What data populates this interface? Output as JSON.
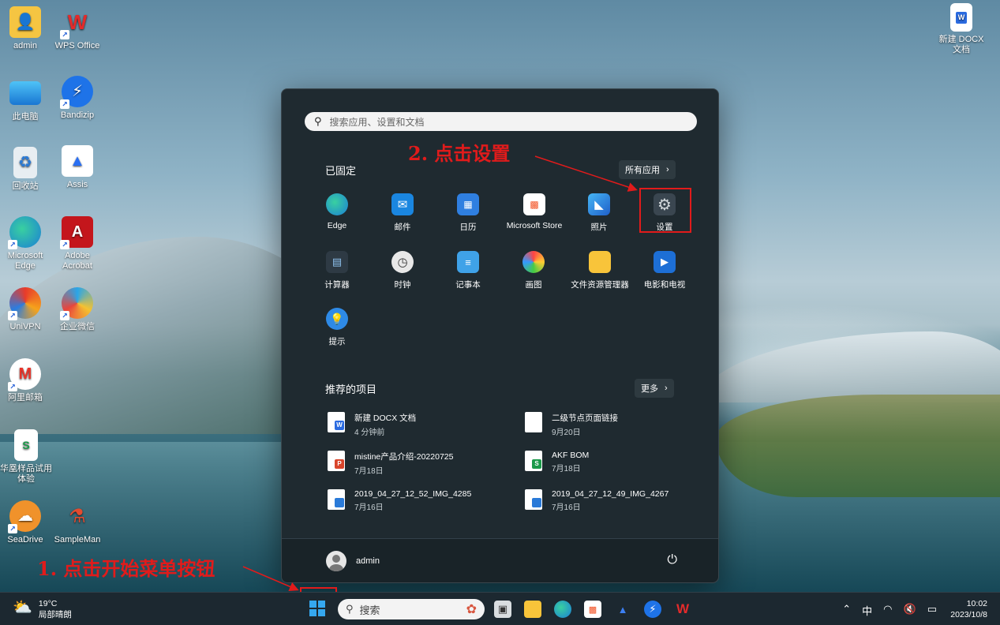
{
  "desktop": {
    "icons": [
      {
        "label": "admin",
        "icon": "user-folder-icon"
      },
      {
        "label": "WPS Office",
        "icon": "wps-icon"
      },
      {
        "label": "此电脑",
        "icon": "computer-icon"
      },
      {
        "label": "Bandizip",
        "icon": "bandizip-icon"
      },
      {
        "label": "回收站",
        "icon": "recycle-bin-icon"
      },
      {
        "label": "Assis",
        "icon": "assis-icon"
      },
      {
        "label": "Microsoft Edge",
        "icon": "edge-icon"
      },
      {
        "label": "Adobe Acrobat",
        "icon": "acrobat-icon"
      },
      {
        "label": "UniVPN",
        "icon": "univpn-icon"
      },
      {
        "label": "企业微信",
        "icon": "wecom-icon"
      },
      {
        "label": "阿里邮箱",
        "icon": "aliyun-mail-icon"
      },
      {
        "label": "华凰样品试用体验",
        "icon": "spreadsheet-file-icon"
      },
      {
        "label": "SeaDrive",
        "icon": "seadrive-icon"
      },
      {
        "label": "SampleMan",
        "icon": "sampleman-icon"
      },
      {
        "label": "新建 DOCX 文档",
        "icon": "word-file-icon"
      }
    ]
  },
  "start_menu": {
    "search_placeholder": "搜索应用、设置和文档",
    "pinned_title": "已固定",
    "all_apps_label": "所有应用",
    "pinned_apps": [
      {
        "label": "Edge",
        "icon": "edge-icon"
      },
      {
        "label": "邮件",
        "icon": "mail-icon"
      },
      {
        "label": "日历",
        "icon": "calendar-icon"
      },
      {
        "label": "Microsoft Store",
        "icon": "store-icon"
      },
      {
        "label": "照片",
        "icon": "photos-icon"
      },
      {
        "label": "设置",
        "icon": "settings-gear-icon"
      },
      {
        "label": "计算器",
        "icon": "calculator-icon"
      },
      {
        "label": "时钟",
        "icon": "clock-icon"
      },
      {
        "label": "记事本",
        "icon": "notepad-icon"
      },
      {
        "label": "画图",
        "icon": "paint-icon"
      },
      {
        "label": "文件资源管理器",
        "icon": "file-explorer-icon"
      },
      {
        "label": "电影和电视",
        "icon": "movies-tv-icon"
      },
      {
        "label": "提示",
        "icon": "tips-icon"
      }
    ],
    "recommended_title": "推荐的项目",
    "more_label": "更多",
    "recommended": [
      {
        "name": "新建 DOCX 文档",
        "time": "4 分钟前",
        "type": "W"
      },
      {
        "name": "二级节点页面链接",
        "time": "9月20日",
        "type": ""
      },
      {
        "name": "mistine产品介绍-20220725",
        "time": "7月18日",
        "type": "P"
      },
      {
        "name": "AKF BOM",
        "time": "7月18日",
        "type": "S"
      },
      {
        "name": "2019_04_27_12_52_IMG_4285",
        "time": "7月16日",
        "type": "IMG"
      },
      {
        "name": "2019_04_27_12_49_IMG_4267",
        "time": "7月16日",
        "type": "IMG"
      }
    ],
    "user": "admin"
  },
  "annotations": {
    "step1": "1. 点击开始菜单按钮",
    "step2": "2. 点击设置",
    "color": "#e11b1b"
  },
  "taskbar": {
    "weather_temp": "19°C",
    "weather_desc": "局部晴朗",
    "search_label": "搜索",
    "ime": "中",
    "time": "10:02",
    "date": "2023/10/8"
  }
}
